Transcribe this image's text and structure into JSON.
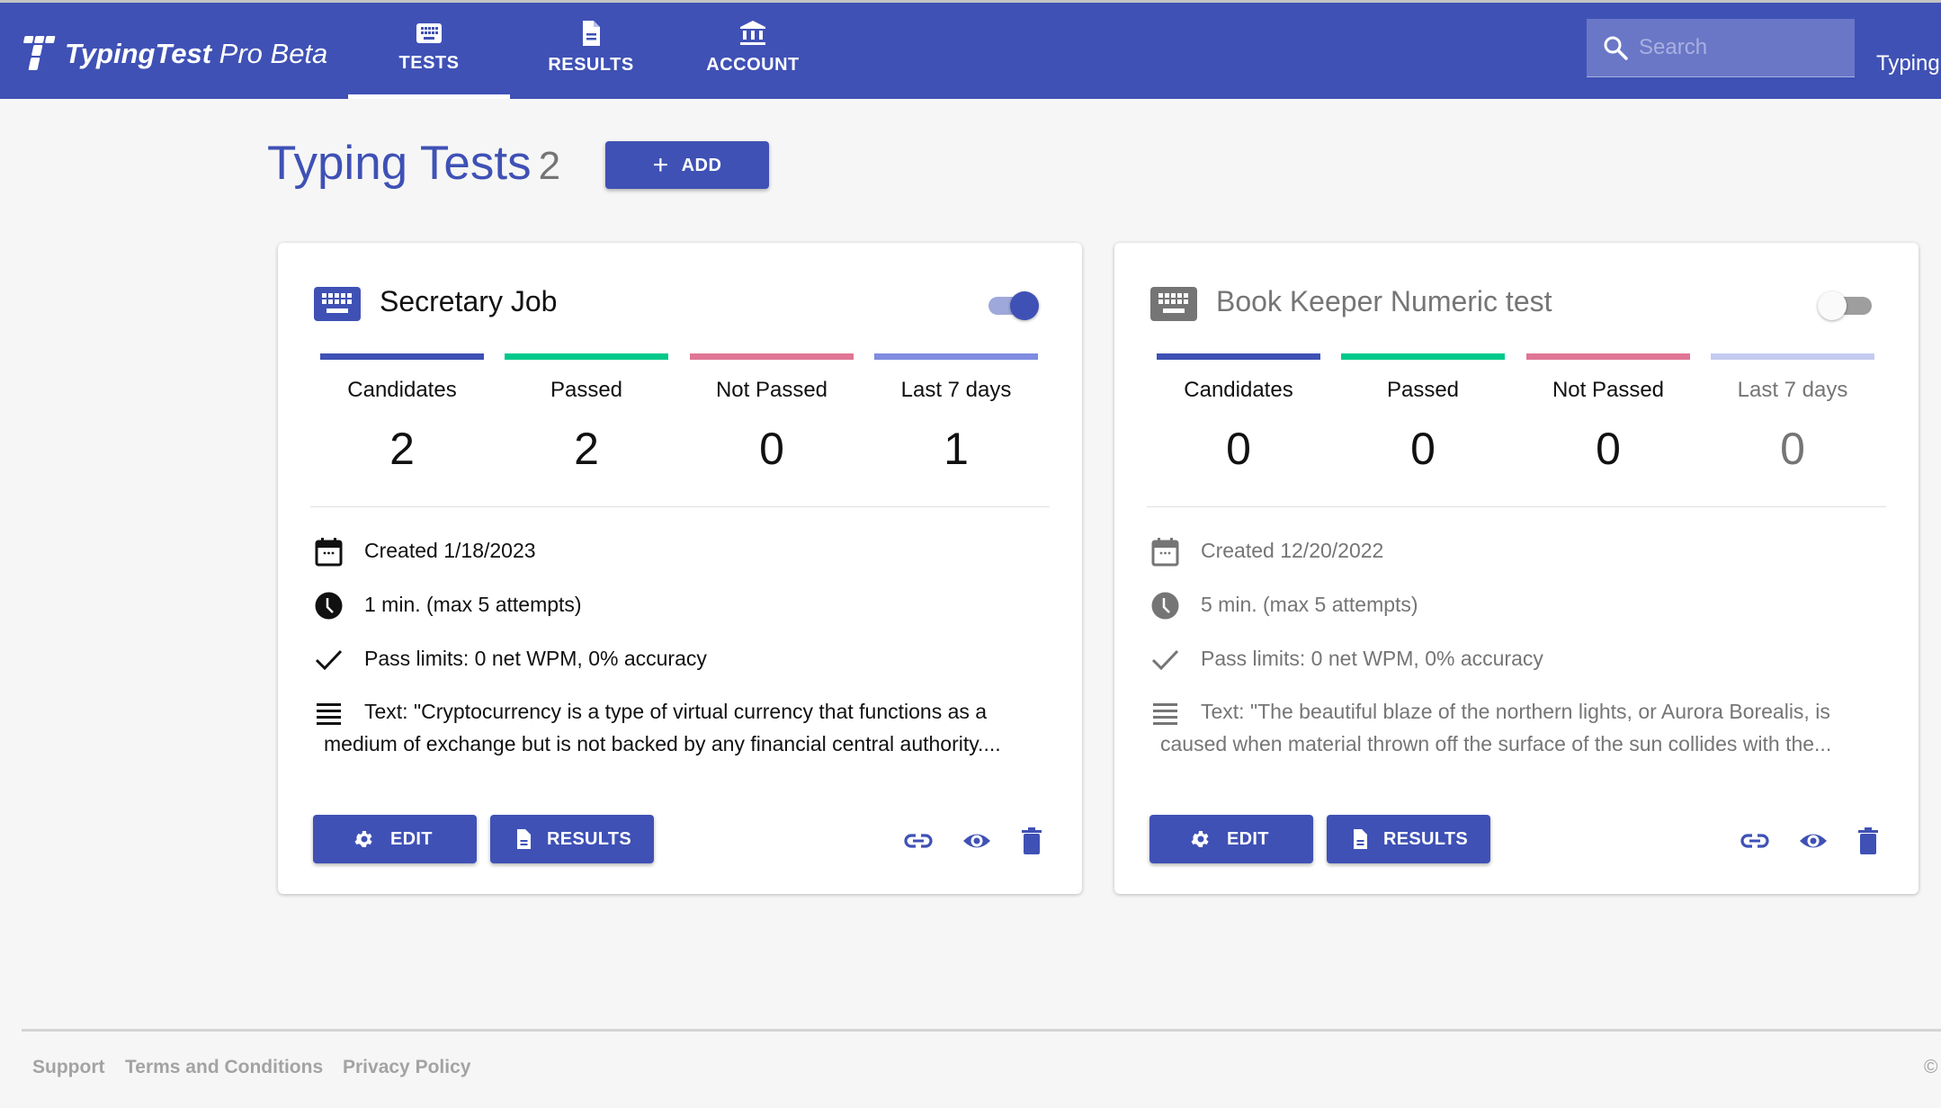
{
  "app": {
    "brand_bold": "TypingTest",
    "brand_rest": " Pro Beta",
    "user_label": "Typing",
    "accent": "#3f51b5"
  },
  "nav": {
    "tabs": [
      {
        "label": "TESTS",
        "icon": "keyboard-icon",
        "active": true
      },
      {
        "label": "RESULTS",
        "icon": "document-icon",
        "active": false
      },
      {
        "label": "ACCOUNT",
        "icon": "bank-icon",
        "active": false
      }
    ]
  },
  "search": {
    "placeholder": "Search",
    "value": ""
  },
  "page": {
    "title": "Typing Tests",
    "count": "2",
    "add_label": "ADD"
  },
  "stat_colors": {
    "candidates": "#3f51b5",
    "passed": "#00c98a",
    "not_passed": "#e07595",
    "last7": "#7f8ce0",
    "last7_inactive": "#c5cbf0"
  },
  "cards": [
    {
      "title": "Secretary Job",
      "enabled": true,
      "stats": [
        {
          "label": "Candidates",
          "value": "2"
        },
        {
          "label": "Passed",
          "value": "2"
        },
        {
          "label": "Not Passed",
          "value": "0"
        },
        {
          "label": "Last 7 days",
          "value": "1"
        }
      ],
      "created": "Created 1/18/2023",
      "duration": "1 min. (max 5 attempts)",
      "pass_limits": "Pass limits: 0 net WPM, 0% accuracy",
      "text": "Text: \"Cryptocurrency is a type of virtual currency that functions as a medium of exchange but is not backed by any financial central authority....",
      "edit_label": "EDIT",
      "results_label": "RESULTS"
    },
    {
      "title": "Book Keeper Numeric test",
      "enabled": false,
      "stats": [
        {
          "label": "Candidates",
          "value": "0"
        },
        {
          "label": "Passed",
          "value": "0"
        },
        {
          "label": "Not Passed",
          "value": "0"
        },
        {
          "label": "Last 7 days",
          "value": "0"
        }
      ],
      "created": "Created 12/20/2022",
      "duration": "5 min. (max 5 attempts)",
      "pass_limits": "Pass limits: 0 net WPM, 0% accuracy",
      "text": "Text: \"The beautiful blaze of the northern lights, or Aurora Borealis, is caused when material thrown off the surface of the sun collides with the...",
      "edit_label": "EDIT",
      "results_label": "RESULTS"
    }
  ],
  "footer": {
    "links": [
      "Support",
      "Terms and Conditions",
      "Privacy Policy"
    ],
    "copyright": "©"
  }
}
